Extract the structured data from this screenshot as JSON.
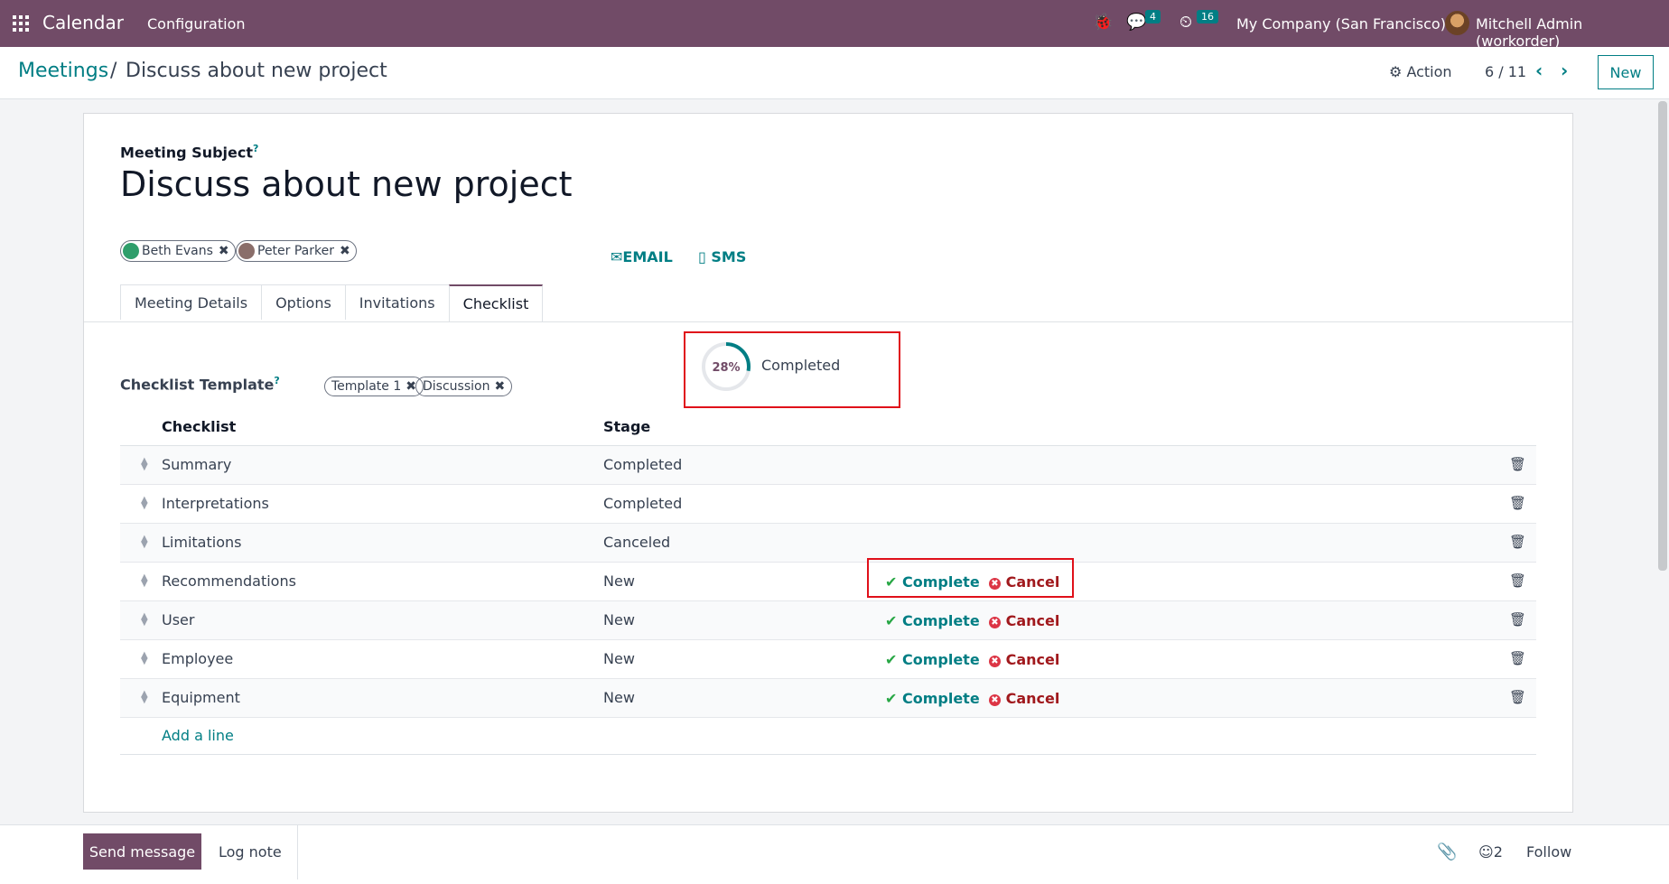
{
  "navbar": {
    "app_name": "Calendar",
    "menu": [
      "Configuration"
    ],
    "messages_badge": "4",
    "activities_badge": "16",
    "company": "My Company (San Francisco)",
    "user": "Mitchell Admin (workorder)"
  },
  "control": {
    "breadcrumb_parent": "Meetings",
    "breadcrumb_sep": "/",
    "breadcrumb_current": "Discuss about new project",
    "action_label": "Action",
    "pager": "6 / 11",
    "new_label": "New"
  },
  "form": {
    "subject_label": "Meeting Subject",
    "help_mark": "?",
    "subject": "Discuss about new project",
    "attendees": [
      {
        "name": "Beth Evans",
        "color": "#2f9e6b"
      },
      {
        "name": "Peter Parker",
        "color": "#8a6e6a"
      }
    ],
    "email_label": "EMAIL",
    "sms_label": "SMS",
    "tabs": [
      "Meeting Details",
      "Options",
      "Invitations",
      "Checklist"
    ],
    "active_tab": "Checklist",
    "progress": {
      "percent_label": "28%",
      "value": 0.28,
      "status": "Completed"
    },
    "template_label": "Checklist Template",
    "templates": [
      "Template 1",
      "Discussion"
    ],
    "columns": {
      "checklist": "Checklist",
      "stage": "Stage"
    },
    "rows": [
      {
        "name": "Summary",
        "stage": "Completed"
      },
      {
        "name": "Interpretations",
        "stage": "Completed"
      },
      {
        "name": "Limitations",
        "stage": "Canceled"
      },
      {
        "name": "Recommendations",
        "stage": "New"
      },
      {
        "name": "User",
        "stage": "New"
      },
      {
        "name": "Employee",
        "stage": "New"
      },
      {
        "name": "Equipment",
        "stage": "New"
      }
    ],
    "complete_label": "Complete",
    "cancel_label": "Cancel",
    "add_line": "Add a line"
  },
  "chatter": {
    "send_message": "Send message",
    "log_note": "Log note",
    "followers_count": "2",
    "follow": "Follow"
  },
  "colors": {
    "brand": "#714b67",
    "accent": "#017e84",
    "highlight": "#e0101a"
  }
}
